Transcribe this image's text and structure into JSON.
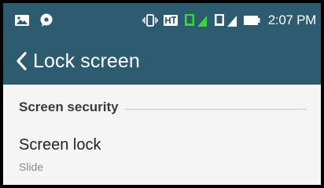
{
  "status_bar": {
    "time": "2:07 PM",
    "icons": [
      "image-notification-icon",
      "chat-notification-icon",
      "vibrate-icon",
      "ht-data-icon",
      "signal-icon-sim1",
      "signal-icon-sim2",
      "battery-icon"
    ]
  },
  "app_bar": {
    "title": "Lock screen",
    "background_color": "#2d5b70"
  },
  "section": {
    "header": "Screen security"
  },
  "screen_lock": {
    "title": "Screen lock",
    "value": "Slide"
  }
}
